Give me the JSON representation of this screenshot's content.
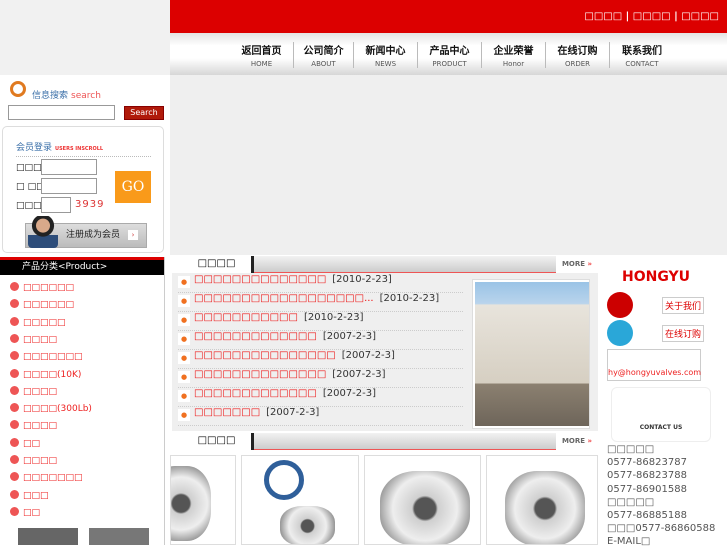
{
  "header": {
    "top_links": "□□□□ | □□□□ | □□□□",
    "nav": [
      {
        "cn": "返回首页",
        "en": "HOME"
      },
      {
        "cn": "公司简介",
        "en": "ABOUT"
      },
      {
        "cn": "新闻中心",
        "en": "NEWS"
      },
      {
        "cn": "产品中心",
        "en": "PRODUCT"
      },
      {
        "cn": "企业荣誉",
        "en": "Honor"
      },
      {
        "cn": "在线订购",
        "en": "ORDER"
      },
      {
        "cn": "联系我们",
        "en": "CONTACT"
      }
    ]
  },
  "search": {
    "title": "信息搜索",
    "title_en": "search",
    "button": "Search",
    "value": ""
  },
  "login": {
    "title": "会员登录",
    "title_en": "USERS INSCROLL",
    "user_label": "□□□□",
    "pass_label": "□ □□",
    "code_label": "□□□□",
    "code": "3939",
    "go": "GO",
    "register": "注册成为会员"
  },
  "categories": {
    "title": "产品分类<Product>",
    "items": [
      "□□□□□□",
      "□□□□□□",
      "□□□□□",
      "□□□□",
      "□□□□□□□",
      "□□□□(10K)",
      "□□□□",
      "□□□□(300Lb)",
      "□□□□",
      "□□",
      "□□□□",
      "□□□□□□□",
      "□□□",
      "□□"
    ]
  },
  "news": {
    "title": "□□□□",
    "more": "MORE",
    "items": [
      {
        "title": "□□□□□□□□□□□□□□",
        "date": "[2010-2-23]"
      },
      {
        "title": "□□□□□□□□□□□□□□□□□□...",
        "date": "[2010-2-23]"
      },
      {
        "title": "□□□□□□□□□□□",
        "date": "[2010-2-23]"
      },
      {
        "title": "□□□□□□□□□□□□□",
        "date": "[2007-2-3]"
      },
      {
        "title": "□□□□□□□□□□□□□□□",
        "date": "[2007-2-3]"
      },
      {
        "title": "□□□□□□□□□□□□□□",
        "date": "[2007-2-3]"
      },
      {
        "title": "□□□□□□□□□□□□□",
        "date": "[2007-2-3]"
      },
      {
        "title": "□□□□□□□",
        "date": "[2007-2-3]"
      }
    ]
  },
  "products": {
    "title": "□□□□",
    "more": "MORE"
  },
  "sidebar_right": {
    "logo": "HONGYU",
    "about": "关于我们",
    "order": "在线订购",
    "email": "hy@hongyuvalves.com",
    "contact_us": "CONTACT US",
    "contact_lines": [
      "□□□□□",
      "0577-86823787",
      "0577-86823788",
      "0577-86901588",
      "□□□□□",
      "0577-86885188",
      "□□□0577-86860588",
      "E-MAIL□"
    ]
  }
}
